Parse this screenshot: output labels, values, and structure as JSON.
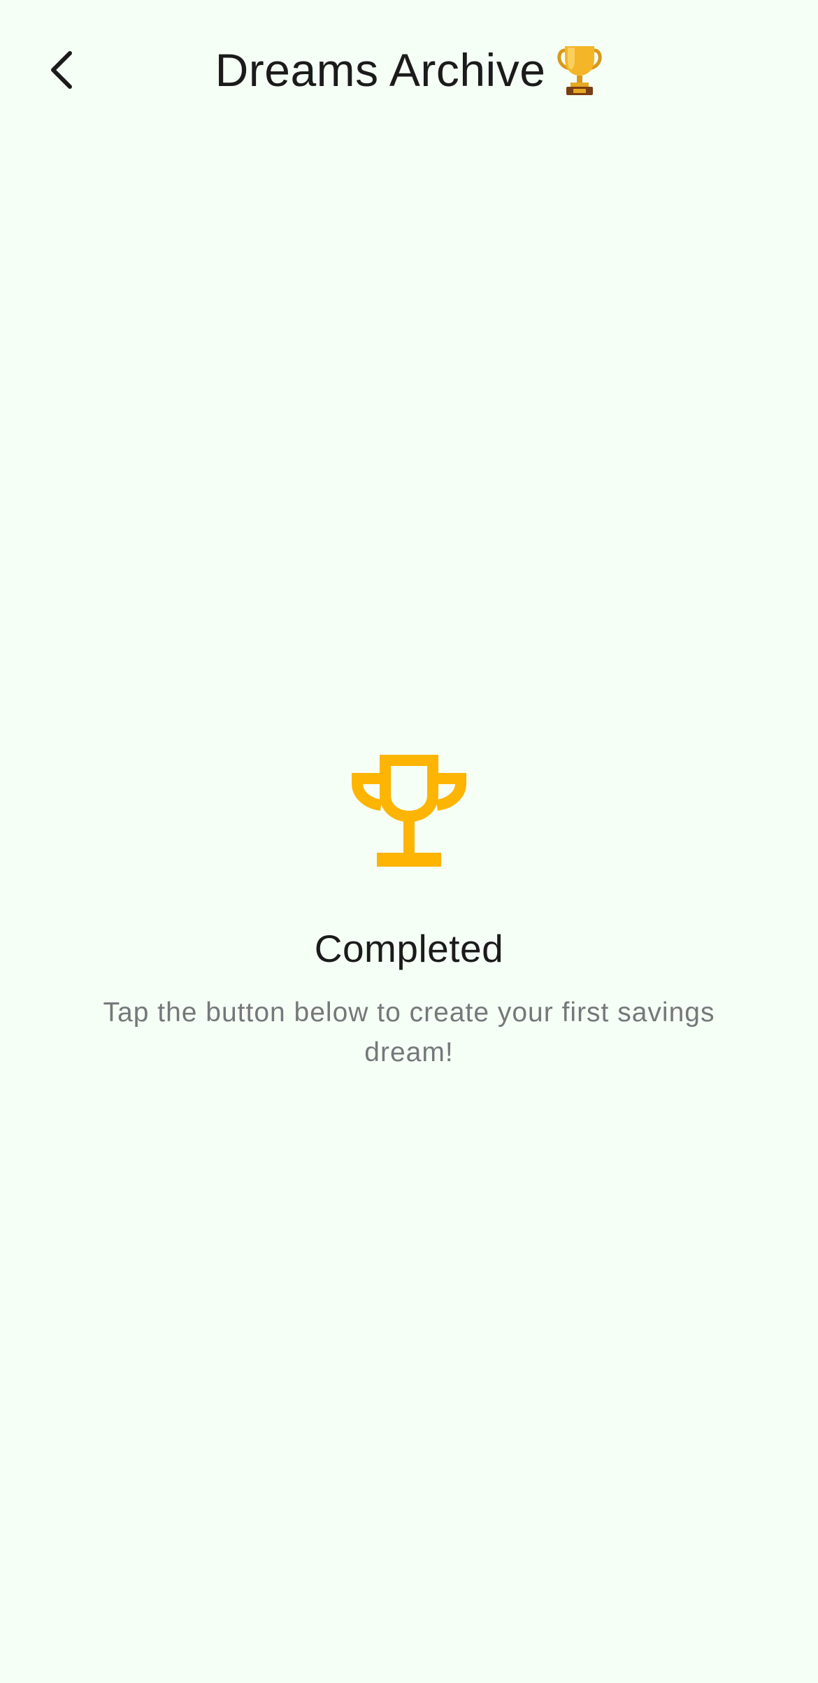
{
  "header": {
    "back_icon": "chevron-left-icon",
    "title": "Dreams Archive",
    "title_emoji": "trophy-emoji-icon"
  },
  "empty_state": {
    "icon": "trophy-icon",
    "icon_color": "#FDB402",
    "title": "Completed",
    "subtitle": "Tap the button below to create your first savings dream!"
  },
  "colors": {
    "background": "#F6FFF6",
    "title_text": "#1B1B1B",
    "subtitle_text": "#75787A"
  }
}
